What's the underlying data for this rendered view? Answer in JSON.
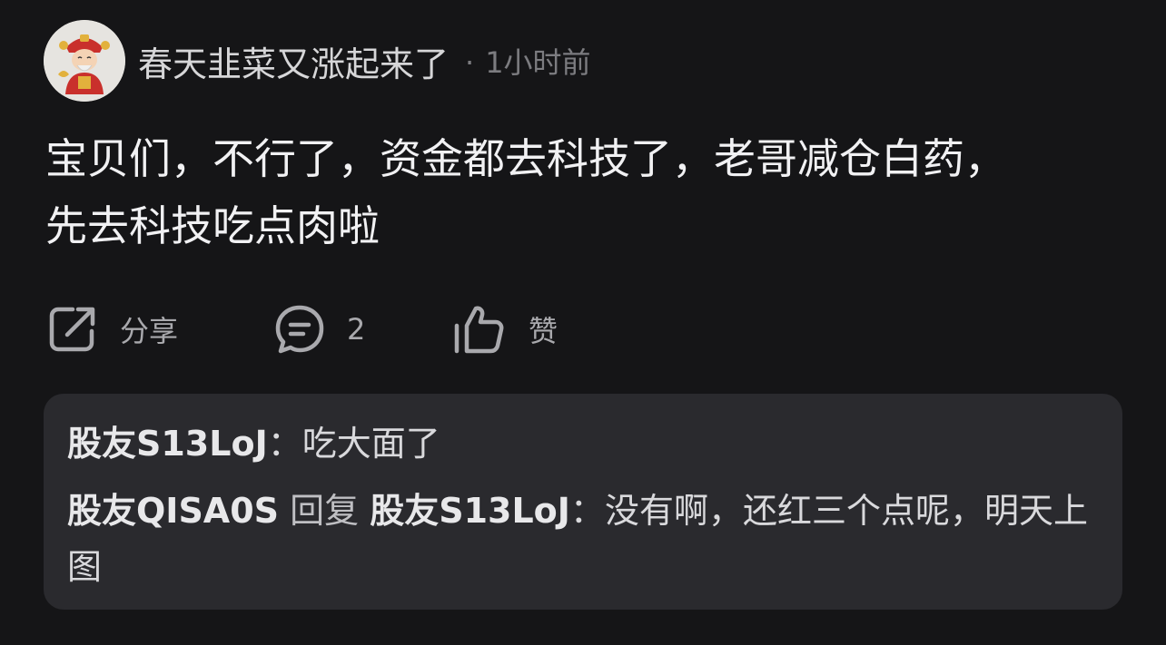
{
  "post": {
    "author": "春天韭菜又涨起来了",
    "time_dot": "·",
    "time": "1小时前",
    "text": "宝贝们，不行了，资金都去科技了，老哥减仓白药，\n先去科技吃点肉啦"
  },
  "actions": {
    "share_label": "分享",
    "comment_count": "2",
    "like_label": "赞"
  },
  "replies": [
    {
      "author": "股友S13LoJ",
      "separator": "：",
      "text": "吃大面了"
    },
    {
      "author": "股友QISA0S",
      "reply_word": " 回复 ",
      "target": "股友S13LoJ",
      "separator": "：",
      "text": "没有啊，还红三个点呢，明天上图"
    }
  ],
  "icons": {
    "share": "share-icon",
    "comment": "comment-bubble-icon",
    "like": "thumbs-up-icon"
  },
  "colors": {
    "background": "#151517",
    "reply_box": "#2a2a2e",
    "primary_text": "#f1f1f3",
    "secondary_text": "#a9a9ad"
  }
}
